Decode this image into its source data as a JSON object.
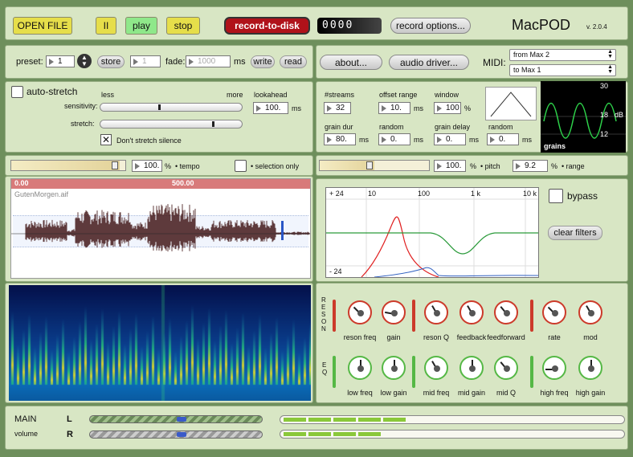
{
  "app": {
    "title": "MacPOD",
    "version": "v. 2.0.4"
  },
  "toolbar": {
    "open_file": "OPEN FILE",
    "pause": "II",
    "play": "play",
    "stop": "stop",
    "record_to_disk": "record-to-disk",
    "counter": "0000",
    "record_options": "record options..."
  },
  "preset": {
    "label": "preset:",
    "value": "1",
    "store_label": "store",
    "store_value": "1",
    "fade_label": "fade:",
    "fade_value": "1000",
    "fade_unit": "ms",
    "write_label": "write",
    "read_label": "read"
  },
  "about": {
    "about_label": "about...",
    "driver_label": "audio driver...",
    "midi_label": "MIDI:",
    "midi_in": "from Max 2",
    "midi_out": "to Max 1"
  },
  "autostretch": {
    "label": "auto-stretch",
    "less": "less",
    "more": "more",
    "sensitivity_label": "sensitivity:",
    "sensitivity": 0.42,
    "stretch_label": "stretch:",
    "stretch": 0.81,
    "lookahead_label": "lookahead",
    "lookahead_value": "100.",
    "lookahead_unit": "ms",
    "dont_stretch": "Don't stretch silence"
  },
  "grains": {
    "streams_label": "#streams",
    "streams_value": "32",
    "offset_label": "offset range",
    "offset_value": "10.",
    "offset_unit": "ms",
    "window_label": "window",
    "window_value": "100",
    "window_unit": "%",
    "grain_dur_label": "grain dur",
    "grain_dur_value": "80.",
    "grain_dur_unit": "ms",
    "random1_label": "random",
    "random1_value": "0.",
    "random1_unit": "ms",
    "grain_delay_label": "grain delay",
    "grain_delay_value": "0.",
    "grain_delay_unit": "ms",
    "random2_label": "random",
    "random2_value": "0.",
    "random2_unit": "ms",
    "scope_label": "grains",
    "scope_db": "dB",
    "scope_ticks": [
      "30",
      "18",
      "12"
    ]
  },
  "tempo": {
    "value": "100.",
    "unit": "%",
    "label": "• tempo",
    "level": 0.95,
    "selection_label": "• selection only"
  },
  "pitch": {
    "value": "100.",
    "unit": "%",
    "label": "• pitch",
    "level": 0.5,
    "range_value": "9.2",
    "range_unit": "%",
    "range_label": "• range"
  },
  "waveform": {
    "start": "0.00",
    "mid": "500.00",
    "filename": "GutenMorgen.aif"
  },
  "filter": {
    "y_top": "+ 24",
    "y_bottom": "- 24",
    "x_ticks": [
      "10",
      "100",
      "1 k",
      "10 k"
    ],
    "bypass_label": "bypass",
    "clear_label": "clear filters"
  },
  "reson": {
    "side_label": "RESON",
    "knobs": [
      {
        "label": "reson freq",
        "angle": -45
      },
      {
        "label": "gain",
        "angle": -80
      },
      {
        "label": "reson Q",
        "angle": -30
      },
      {
        "label": "feedback",
        "angle": -30
      },
      {
        "label": "feedforward",
        "angle": -40
      },
      {
        "label": "rate",
        "angle": -45
      },
      {
        "label": "mod",
        "angle": -30
      }
    ]
  },
  "eq": {
    "side_label": "EQ",
    "knobs": [
      {
        "label": "low freq",
        "angle": 0
      },
      {
        "label": "low gain",
        "angle": 0
      },
      {
        "label": "mid freq",
        "angle": -30
      },
      {
        "label": "mid gain",
        "angle": 0
      },
      {
        "label": "mid Q",
        "angle": -40
      },
      {
        "label": "high freq",
        "angle": -90
      },
      {
        "label": "high gain",
        "angle": 0
      }
    ]
  },
  "main": {
    "label": "MAIN",
    "sub": "volume",
    "l": "L",
    "r": "R",
    "l_level": 0.54,
    "r_level": 0.54,
    "meter_l": 0.4,
    "meter_r": 0.36
  },
  "colors": {
    "accent": "#e6de4a",
    "record": "#b0121a",
    "play": "#8fe88a",
    "panel": "#d8e6c4",
    "outer": "#6e8f5c",
    "reson": "#cc3a2a",
    "eq": "#55b845"
  }
}
